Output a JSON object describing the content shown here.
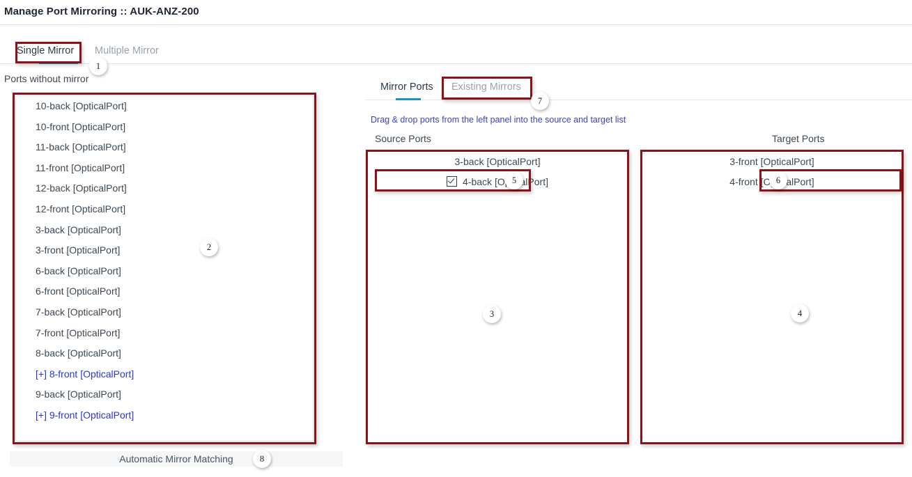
{
  "window": {
    "title": "Manage Port Mirroring :: AUK-ANZ-200"
  },
  "top_tabs": {
    "active": "Single Mirror",
    "items": [
      {
        "label": "Single Mirror",
        "active": true
      },
      {
        "label": "Multiple Mirror",
        "active": false
      }
    ]
  },
  "left_panel": {
    "label": "Ports without mirror",
    "ports": [
      {
        "label": "10-back [OpticalPort]",
        "link": false
      },
      {
        "label": "10-front [OpticalPort]",
        "link": false
      },
      {
        "label": "11-back [OpticalPort]",
        "link": false
      },
      {
        "label": "11-front [OpticalPort]",
        "link": false
      },
      {
        "label": "12-back [OpticalPort]",
        "link": false
      },
      {
        "label": "12-front [OpticalPort]",
        "link": false
      },
      {
        "label": "3-back [OpticalPort]",
        "link": false
      },
      {
        "label": "3-front [OpticalPort]",
        "link": false
      },
      {
        "label": "6-back [OpticalPort]",
        "link": false
      },
      {
        "label": "6-front [OpticalPort]",
        "link": false
      },
      {
        "label": "7-back [OpticalPort]",
        "link": false
      },
      {
        "label": "7-front [OpticalPort]",
        "link": false
      },
      {
        "label": "8-back [OpticalPort]",
        "link": false
      },
      {
        "label": "[+] 8-front [OpticalPort]",
        "link": true
      },
      {
        "label": "9-back [OpticalPort]",
        "link": false
      },
      {
        "label": "[+] 9-front [OpticalPort]",
        "link": true
      }
    ],
    "auto_mirror_matching_label": "Automatic Mirror Matching"
  },
  "right_panel": {
    "sub_tabs": [
      {
        "label": "Mirror Ports",
        "active": true
      },
      {
        "label": "Existing Mirrors",
        "active": false
      }
    ],
    "hint": "Drag & drop ports from the left panel into the source and target list",
    "source": {
      "label": "Source Ports",
      "items": [
        {
          "label": "3-back [OpticalPort]",
          "checked": false
        },
        {
          "label": "4-back [OpticalPort]",
          "checked": true
        }
      ]
    },
    "target": {
      "label": "Target Ports",
      "items": [
        {
          "label": "3-front [OpticalPort]",
          "checked": false
        },
        {
          "label": "4-front [OpticalPort]",
          "checked": false
        }
      ]
    }
  },
  "annotations": {
    "markers": [
      {
        "id": "1",
        "number": "1"
      },
      {
        "id": "2",
        "number": "2"
      },
      {
        "id": "3",
        "number": "3"
      },
      {
        "id": "4",
        "number": "4"
      },
      {
        "id": "5",
        "number": "5"
      },
      {
        "id": "6",
        "number": "6"
      },
      {
        "id": "7",
        "number": "7"
      },
      {
        "id": "8",
        "number": "8"
      }
    ],
    "highlight_color": "#8d1118"
  },
  "colors": {
    "accent_underline": "#1a93c6",
    "link": "#2b35d6",
    "hint": "#3b42c4",
    "annotation": "#8d1118"
  }
}
